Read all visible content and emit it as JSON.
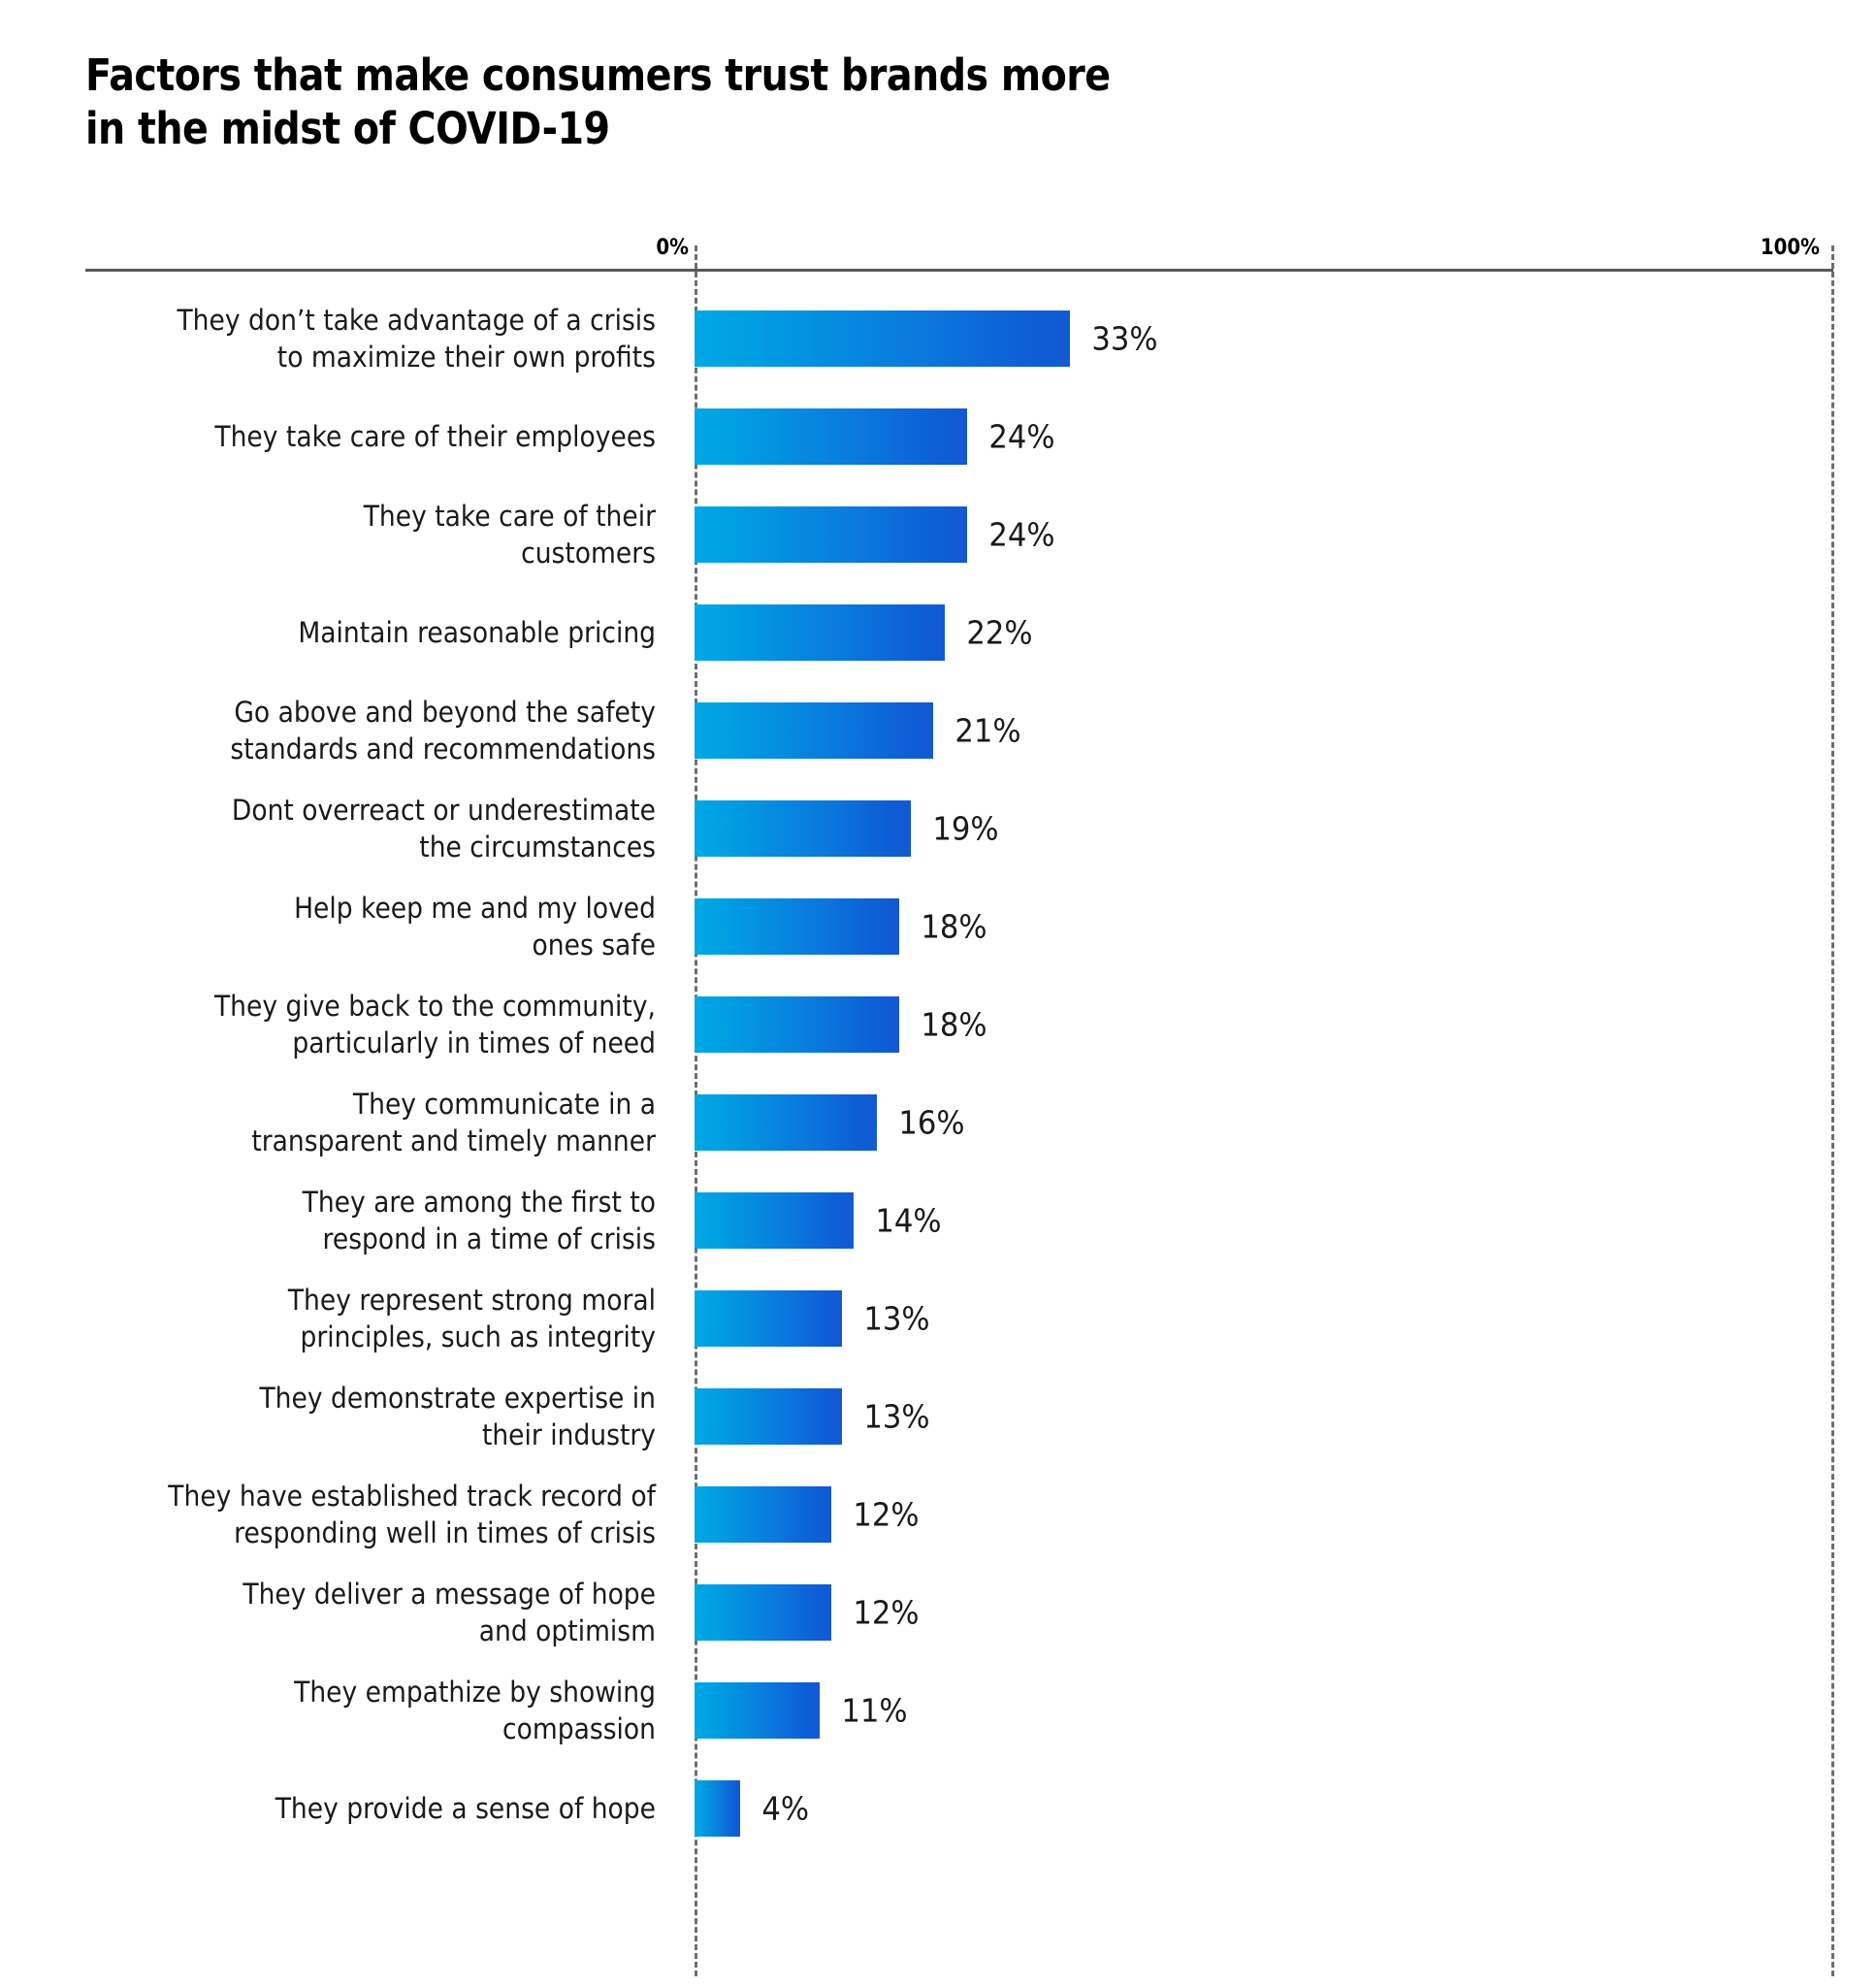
{
  "chart_data": {
    "type": "bar",
    "orientation": "horizontal",
    "title": "Factors that make consumers trust brands more\nin the midst of COVID-19",
    "subtitle": "",
    "xlabel": "",
    "ylabel": "",
    "xlim": [
      0,
      100
    ],
    "axis_tick_labels": [
      "0%",
      "100%"
    ],
    "grid": "vertical dashed at 0% and 100%",
    "legend": "none",
    "value_suffix": "%",
    "bar_gradient_start": "#00A8E4",
    "bar_gradient_end": "#1259D4",
    "axis_color": "#58595B",
    "gridline_color": "#6D6E71",
    "text_color": "#1A1A1A",
    "categories": [
      "They don’t take advantage of a crisis\nto maximize their own profits",
      "They take care of their employees",
      "They take care of their\ncustomers",
      "Maintain reasonable pricing",
      "Go above and beyond the safety\nstandards and recommendations",
      "Dont overreact or underestimate\nthe circumstances",
      "Help keep me and my loved\nones safe",
      "They give back to the community,\nparticularly in times of need",
      "They communicate in a\ntransparent and timely  manner",
      "They are among the first to\nrespond in a time of crisis",
      "They represent strong moral\nprinciples, such as integrity",
      "They demonstrate expertise in\ntheir industry",
      "They have established track record of\nresponding well in times of crisis",
      "They deliver a message of hope\nand optimism",
      "They empathize by showing\ncompassion",
      "They provide a sense of hope"
    ],
    "values": [
      33,
      24,
      24,
      22,
      21,
      19,
      18,
      18,
      16,
      14,
      13,
      13,
      12,
      12,
      11,
      4
    ],
    "value_labels": [
      "33%",
      "24%",
      "24%",
      "22%",
      "21%",
      "19%",
      "18%",
      "18%",
      "16%",
      "14%",
      "13%",
      "13%",
      "12%",
      "12%",
      "11%",
      "4%"
    ]
  }
}
